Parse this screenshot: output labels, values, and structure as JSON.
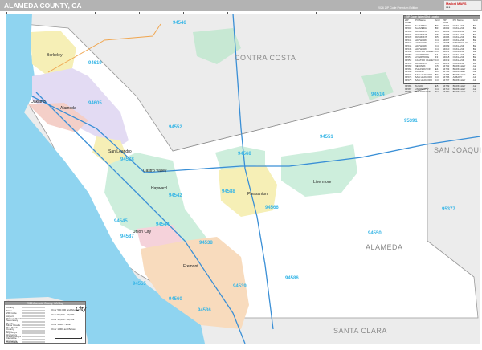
{
  "header": {
    "title": "ALAMEDA COUNTY, CA",
    "edition": "2026 ZIP Code Premium Edition",
    "logo": "Market MAPS"
  },
  "regions": [
    "CONTRA COSTA",
    "SAN JOAQUIN",
    "ALAMEDA",
    "SANTA CLARA"
  ],
  "cities": [
    "Berkeley",
    "Oakland",
    "Alameda",
    "San Leandro",
    "Castro Valley",
    "Hayward",
    "Union City",
    "Fremont",
    "Pleasanton",
    "Livermore"
  ],
  "zips": [
    "94514",
    "94551",
    "95391",
    "94552",
    "94568",
    "94588",
    "94566",
    "94550",
    "95377",
    "94586",
    "94545",
    "94544",
    "94542",
    "94587",
    "94538",
    "94555",
    "94560",
    "94539",
    "94536",
    "94546",
    "94578",
    "94619",
    "94605"
  ],
  "table": {
    "title": "ZIP Code Index/Grid Locator",
    "headers": [
      "ZIP Code",
      "PO Name",
      "Grid"
    ],
    "rows": [
      [
        "94501",
        "ALAMEDA",
        "B3"
      ],
      [
        "94502",
        "ALAMEDA",
        "B3"
      ],
      [
        "94536",
        "FREMONT",
        "D5"
      ],
      [
        "94538",
        "FREMONT",
        "D5"
      ],
      [
        "94539",
        "FREMONT",
        "D5"
      ],
      [
        "94541",
        "HAYWARD",
        "C4"
      ],
      [
        "94542",
        "HAYWARD",
        "C4"
      ],
      [
        "94544",
        "HAYWARD",
        "C4"
      ],
      [
        "94545",
        "HAYWARD",
        "C4"
      ],
      [
        "94546",
        "CASTRO VALLEY",
        "C3"
      ],
      [
        "94550",
        "LIVERMORE",
        "F4"
      ],
      [
        "94551",
        "LIVERMORE",
        "F3"
      ],
      [
        "94552",
        "CASTRO VALLEY",
        "C3"
      ],
      [
        "94555",
        "FREMONT",
        "C5"
      ],
      [
        "94560",
        "NEWARK",
        "C5"
      ],
      [
        "94566",
        "PLEASANTON",
        "E4"
      ],
      [
        "94568",
        "DUBLIN",
        "D3"
      ],
      [
        "94577",
        "SAN LEANDRO",
        "B3"
      ],
      [
        "94578",
        "SAN LEANDRO",
        "C3"
      ],
      [
        "94579",
        "SAN LEANDRO",
        "C3"
      ],
      [
        "94580",
        "SAN LORENZO",
        "C3"
      ],
      [
        "94586",
        "SUNOL",
        "E5"
      ],
      [
        "94587",
        "UNION CITY",
        "C4"
      ],
      [
        "94588",
        "PLEASANTON",
        "D4"
      ],
      [
        "94601",
        "OAKLAND",
        "B3"
      ],
      [
        "94602",
        "OAKLAND",
        "B2"
      ],
      [
        "94603",
        "OAKLAND",
        "B3"
      ],
      [
        "94605",
        "OAKLAND",
        "B3"
      ],
      [
        "94606",
        "OAKLAND",
        "B2"
      ],
      [
        "94607",
        "OAKLAND",
        "B2"
      ],
      [
        "94608",
        "EMERYVILLE",
        "A2"
      ],
      [
        "94609",
        "OAKLAND",
        "B2"
      ],
      [
        "94610",
        "OAKLAND",
        "B2"
      ],
      [
        "94611",
        "OAKLAND",
        "B2"
      ],
      [
        "94612",
        "OAKLAND",
        "B2"
      ],
      [
        "94618",
        "OAKLAND",
        "B2"
      ],
      [
        "94619",
        "OAKLAND",
        "B3"
      ],
      [
        "94621",
        "OAKLAND",
        "B3"
      ],
      [
        "94702",
        "BERKELEY",
        "A2"
      ],
      [
        "94703",
        "BERKELEY",
        "A2"
      ],
      [
        "94704",
        "BERKELEY",
        "A2"
      ],
      [
        "94705",
        "BERKELEY",
        "B2"
      ],
      [
        "94706",
        "ALBANY",
        "A1"
      ],
      [
        "94707",
        "BERKELEY",
        "A1"
      ],
      [
        "94708",
        "BERKELEY",
        "A1"
      ],
      [
        "94709",
        "BERKELEY",
        "A2"
      ],
      [
        "94710",
        "BERKELEY",
        "A2"
      ],
      [
        "94720",
        "BERKELEY",
        "A2"
      ]
    ]
  },
  "legend": {
    "title": "2026 Alameda County, CA Map",
    "items": [
      {
        "label": "County",
        "color": "#bbbbbb"
      },
      {
        "label": "State",
        "color": "#888888"
      },
      {
        "label": "ZIP Code",
        "color": "#9fdcf2"
      },
      {
        "label": "Airport",
        "color": "#ffffff"
      },
      {
        "label": "Primary Roads",
        "color": "#ffffff"
      },
      {
        "label": "Secondary Roads",
        "color": "#ffffff"
      },
      {
        "label": "Minor Roads",
        "color": "#ffffff"
      },
      {
        "label": "Rail Roads",
        "color": "#f3d6d6"
      },
      {
        "label": "County Highways",
        "color": "#e6e6e6"
      },
      {
        "label": "State Highways",
        "color": "#f8c98a"
      },
      {
        "label": "US Highways",
        "color": "#ee5fb0"
      },
      {
        "label": "Interstate Highways",
        "color": "#3a8fd6"
      },
      {
        "label": "Toll Roads",
        "color": "#5fd35f"
      }
    ],
    "population": [
      "Over 500,000 and Above",
      "Over 50,000 - 99,999",
      "Over 10,000 - 49,999",
      "Over 1,000 - 9,999",
      "Over 1,000 and Below"
    ],
    "city_sample": "City"
  }
}
